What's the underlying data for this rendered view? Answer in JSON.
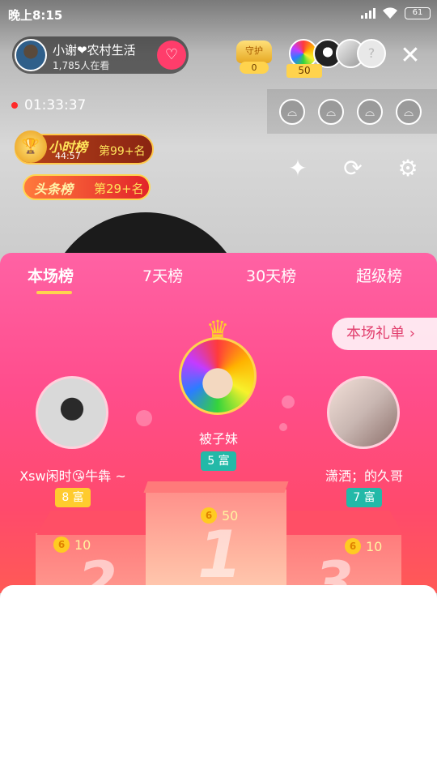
{
  "status_bar": {
    "time": "晚上8:15",
    "battery": "61",
    "icons": [
      "signal-icon",
      "wifi-icon",
      "battery-icon"
    ]
  },
  "host": {
    "name": "小谢❤农村生活",
    "viewers": "1,785人在看",
    "follow_icon": "heart-plus-icon"
  },
  "guard": {
    "label": "守护",
    "count": "0"
  },
  "viewers": {
    "coins": "50"
  },
  "live": {
    "timer": "01:33:37"
  },
  "badges": {
    "hour": {
      "title": "小时榜",
      "time": "44:57",
      "rank": "第99+名"
    },
    "headline": {
      "title": "头条榜",
      "rank": "第29+名"
    }
  },
  "ranking": {
    "tabs": [
      "本场榜",
      "7天榜",
      "30天榜",
      "超级榜"
    ],
    "active_tab": 0,
    "gift_list_label": "本场礼单 ›",
    "first": {
      "name": "被子妹",
      "rich": "5 富",
      "score": "50",
      "podium": "1"
    },
    "second": {
      "name": "Xsw闲时😘牛犇 ~",
      "rich": "8 富",
      "score": "10",
      "podium": "2"
    },
    "third": {
      "name": "潇洒；的久哥",
      "rich": "7 富",
      "score": "10",
      "podium": "3"
    },
    "coin_glyph": "6"
  },
  "colors": {
    "panel_top": "#ff62a4",
    "panel_bottom": "#ff5a55",
    "accent_yellow": "#ffd34d",
    "rich_teal": "#23b9a8"
  }
}
